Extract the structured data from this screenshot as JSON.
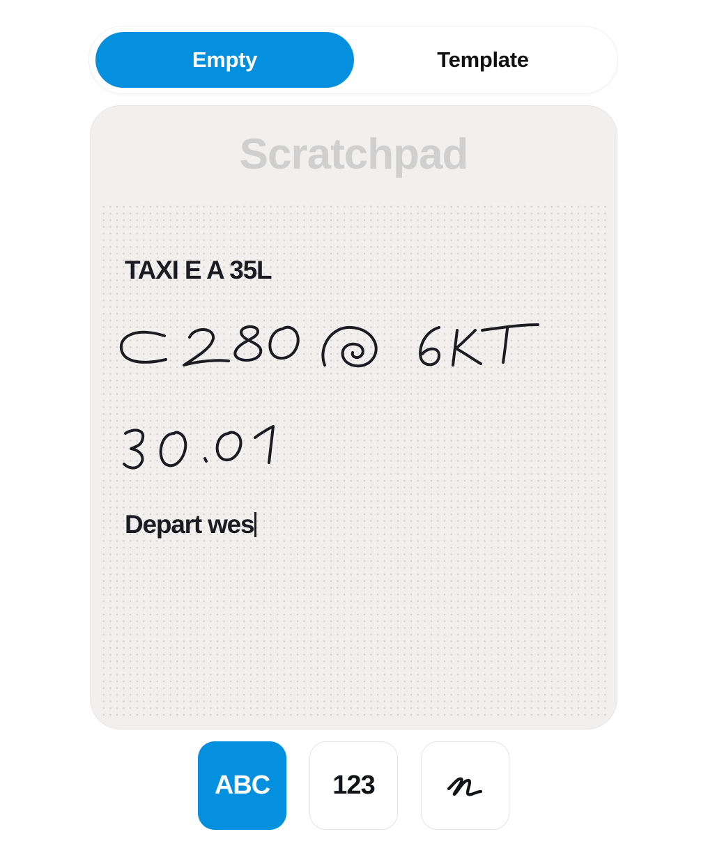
{
  "tabs": {
    "items": [
      {
        "label": "Empty",
        "active": true
      },
      {
        "label": "Template",
        "active": false
      }
    ]
  },
  "scratchpad": {
    "title": "Scratchpad",
    "typed_lines": [
      "TAXI E A 35L",
      "Depart wes"
    ],
    "handwritten_lines": [
      "C 280 @ 6KT",
      "30.01"
    ]
  },
  "modes": {
    "items": [
      {
        "label": "ABC",
        "active": true
      },
      {
        "label": "123",
        "active": false
      },
      {
        "icon": "handwriting-icon",
        "active": false
      }
    ]
  },
  "colors": {
    "accent": "#0590df",
    "card_background": "#f1f0ee",
    "title_muted": "#cfcfcf",
    "ink": "#1b1d22"
  }
}
